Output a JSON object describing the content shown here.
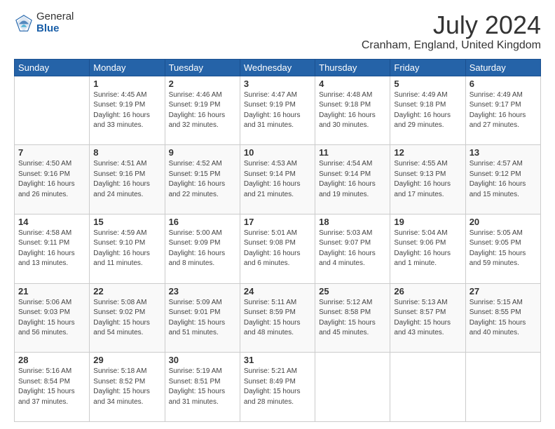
{
  "logo": {
    "general": "General",
    "blue": "Blue"
  },
  "title": "July 2024",
  "location": "Cranham, England, United Kingdom",
  "days_of_week": [
    "Sunday",
    "Monday",
    "Tuesday",
    "Wednesday",
    "Thursday",
    "Friday",
    "Saturday"
  ],
  "weeks": [
    [
      {
        "day": "",
        "info": ""
      },
      {
        "day": "1",
        "info": "Sunrise: 4:45 AM\nSunset: 9:19 PM\nDaylight: 16 hours\nand 33 minutes."
      },
      {
        "day": "2",
        "info": "Sunrise: 4:46 AM\nSunset: 9:19 PM\nDaylight: 16 hours\nand 32 minutes."
      },
      {
        "day": "3",
        "info": "Sunrise: 4:47 AM\nSunset: 9:19 PM\nDaylight: 16 hours\nand 31 minutes."
      },
      {
        "day": "4",
        "info": "Sunrise: 4:48 AM\nSunset: 9:18 PM\nDaylight: 16 hours\nand 30 minutes."
      },
      {
        "day": "5",
        "info": "Sunrise: 4:49 AM\nSunset: 9:18 PM\nDaylight: 16 hours\nand 29 minutes."
      },
      {
        "day": "6",
        "info": "Sunrise: 4:49 AM\nSunset: 9:17 PM\nDaylight: 16 hours\nand 27 minutes."
      }
    ],
    [
      {
        "day": "7",
        "info": "Sunrise: 4:50 AM\nSunset: 9:16 PM\nDaylight: 16 hours\nand 26 minutes."
      },
      {
        "day": "8",
        "info": "Sunrise: 4:51 AM\nSunset: 9:16 PM\nDaylight: 16 hours\nand 24 minutes."
      },
      {
        "day": "9",
        "info": "Sunrise: 4:52 AM\nSunset: 9:15 PM\nDaylight: 16 hours\nand 22 minutes."
      },
      {
        "day": "10",
        "info": "Sunrise: 4:53 AM\nSunset: 9:14 PM\nDaylight: 16 hours\nand 21 minutes."
      },
      {
        "day": "11",
        "info": "Sunrise: 4:54 AM\nSunset: 9:14 PM\nDaylight: 16 hours\nand 19 minutes."
      },
      {
        "day": "12",
        "info": "Sunrise: 4:55 AM\nSunset: 9:13 PM\nDaylight: 16 hours\nand 17 minutes."
      },
      {
        "day": "13",
        "info": "Sunrise: 4:57 AM\nSunset: 9:12 PM\nDaylight: 16 hours\nand 15 minutes."
      }
    ],
    [
      {
        "day": "14",
        "info": "Sunrise: 4:58 AM\nSunset: 9:11 PM\nDaylight: 16 hours\nand 13 minutes."
      },
      {
        "day": "15",
        "info": "Sunrise: 4:59 AM\nSunset: 9:10 PM\nDaylight: 16 hours\nand 11 minutes."
      },
      {
        "day": "16",
        "info": "Sunrise: 5:00 AM\nSunset: 9:09 PM\nDaylight: 16 hours\nand 8 minutes."
      },
      {
        "day": "17",
        "info": "Sunrise: 5:01 AM\nSunset: 9:08 PM\nDaylight: 16 hours\nand 6 minutes."
      },
      {
        "day": "18",
        "info": "Sunrise: 5:03 AM\nSunset: 9:07 PM\nDaylight: 16 hours\nand 4 minutes."
      },
      {
        "day": "19",
        "info": "Sunrise: 5:04 AM\nSunset: 9:06 PM\nDaylight: 16 hours\nand 1 minute."
      },
      {
        "day": "20",
        "info": "Sunrise: 5:05 AM\nSunset: 9:05 PM\nDaylight: 15 hours\nand 59 minutes."
      }
    ],
    [
      {
        "day": "21",
        "info": "Sunrise: 5:06 AM\nSunset: 9:03 PM\nDaylight: 15 hours\nand 56 minutes."
      },
      {
        "day": "22",
        "info": "Sunrise: 5:08 AM\nSunset: 9:02 PM\nDaylight: 15 hours\nand 54 minutes."
      },
      {
        "day": "23",
        "info": "Sunrise: 5:09 AM\nSunset: 9:01 PM\nDaylight: 15 hours\nand 51 minutes."
      },
      {
        "day": "24",
        "info": "Sunrise: 5:11 AM\nSunset: 8:59 PM\nDaylight: 15 hours\nand 48 minutes."
      },
      {
        "day": "25",
        "info": "Sunrise: 5:12 AM\nSunset: 8:58 PM\nDaylight: 15 hours\nand 45 minutes."
      },
      {
        "day": "26",
        "info": "Sunrise: 5:13 AM\nSunset: 8:57 PM\nDaylight: 15 hours\nand 43 minutes."
      },
      {
        "day": "27",
        "info": "Sunrise: 5:15 AM\nSunset: 8:55 PM\nDaylight: 15 hours\nand 40 minutes."
      }
    ],
    [
      {
        "day": "28",
        "info": "Sunrise: 5:16 AM\nSunset: 8:54 PM\nDaylight: 15 hours\nand 37 minutes."
      },
      {
        "day": "29",
        "info": "Sunrise: 5:18 AM\nSunset: 8:52 PM\nDaylight: 15 hours\nand 34 minutes."
      },
      {
        "day": "30",
        "info": "Sunrise: 5:19 AM\nSunset: 8:51 PM\nDaylight: 15 hours\nand 31 minutes."
      },
      {
        "day": "31",
        "info": "Sunrise: 5:21 AM\nSunset: 8:49 PM\nDaylight: 15 hours\nand 28 minutes."
      },
      {
        "day": "",
        "info": ""
      },
      {
        "day": "",
        "info": ""
      },
      {
        "day": "",
        "info": ""
      }
    ]
  ]
}
